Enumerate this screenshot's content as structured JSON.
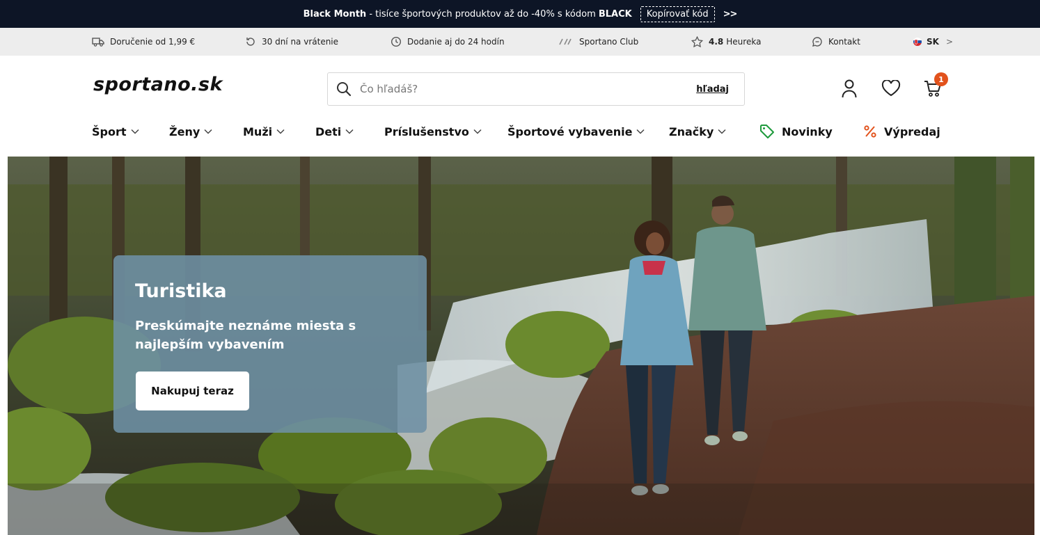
{
  "promo": {
    "bold_lead": "Black Month",
    "text": " - tisíce športových produktov až do -40% s kódom ",
    "code": "BLACK",
    "copy_label": "Kopírovať kód",
    "arrow": ">>"
  },
  "benefits": {
    "delivery": "Doručenie od 1,99 €",
    "returns": "30 dní na vrátenie",
    "shipping_time": "Dodanie aj do 24 hodín",
    "club": "Sportano Club",
    "rating_value": "4.8",
    "rating_source": "Heureka",
    "contact": "Kontakt",
    "country": "SK",
    "country_arrow": ">"
  },
  "header": {
    "logo": "sportano.sk",
    "search_placeholder": "Čo hľadáš?",
    "search_button": "hľadaj",
    "cart_count": "1"
  },
  "nav": {
    "sport": "Šport",
    "women": "Ženy",
    "men": "Muži",
    "kids": "Deti",
    "accessories": "Príslušenstvo",
    "equipment": "Športové vybavenie",
    "brands": "Značky",
    "new": "Novinky",
    "sale": "Výpredaj"
  },
  "hero": {
    "title": "Turistika",
    "subtitle": "Preskúmajte neznáme miesta s najlepším vybavením",
    "cta": "Nakupuj teraz"
  },
  "colors": {
    "promo_bg": "#0d1526",
    "benefits_bg": "#ededed",
    "accent_orange": "#e2521c",
    "new_green": "#1e9a3c",
    "panel": "#6e91a5"
  }
}
